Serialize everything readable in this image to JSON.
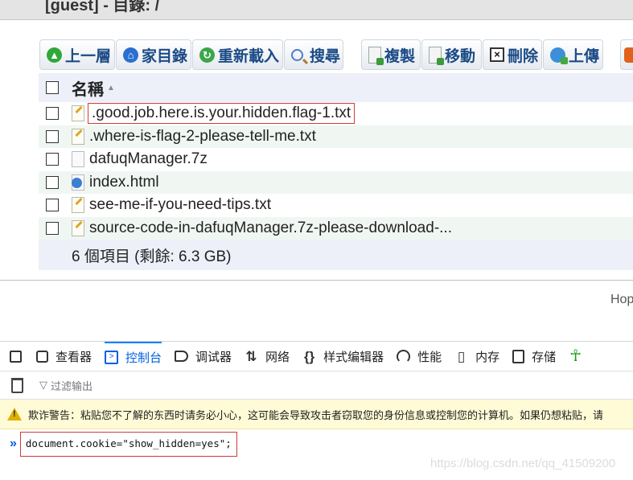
{
  "header": {
    "title": "[guest] - 目錄: /"
  },
  "toolbar": {
    "buttons": [
      {
        "label": "上一層",
        "icon": "arrow-up-icon"
      },
      {
        "label": "家目錄",
        "icon": "home-icon"
      },
      {
        "label": "重新載入",
        "icon": "reload-icon"
      },
      {
        "label": "搜尋",
        "icon": "search-icon"
      },
      {
        "label": "複製",
        "icon": "copy-icon"
      },
      {
        "label": "移動",
        "icon": "move-icon"
      },
      {
        "label": "刪除",
        "icon": "delete-icon"
      },
      {
        "label": "上傳",
        "icon": "upload-icon"
      }
    ]
  },
  "file_list": {
    "column_name": "名稱",
    "sort_indicator": "▲",
    "files": [
      {
        "name": ".good.job.here.is.your.hidden.flag-1.txt",
        "type": "text-file-icon",
        "highlighted": true
      },
      {
        "name": ".where-is-flag-2-please-tell-me.txt",
        "type": "text-file-icon"
      },
      {
        "name": "dafuqManager.7z",
        "type": "archive-file-icon"
      },
      {
        "name": "index.html",
        "type": "html-file-icon"
      },
      {
        "name": "see-me-if-you-need-tips.txt",
        "type": "text-file-icon"
      },
      {
        "name": "source-code-in-dafuqManager.7z-please-download-...",
        "type": "text-file-icon"
      }
    ],
    "summary": "6 個項目 (剩餘: 6.3 GB)"
  },
  "footer_text": "Hop",
  "devtools": {
    "tabs": [
      {
        "label": "查看器",
        "icon": "inspector-icon"
      },
      {
        "label": "控制台",
        "icon": "console-icon",
        "active": true
      },
      {
        "label": "调试器",
        "icon": "debugger-icon"
      },
      {
        "label": "网络",
        "icon": "network-icon"
      },
      {
        "label": "样式编辑器",
        "icon": "style-editor-icon"
      },
      {
        "label": "性能",
        "icon": "performance-icon"
      },
      {
        "label": "内存",
        "icon": "memory-icon"
      },
      {
        "label": "存储",
        "icon": "storage-icon"
      }
    ],
    "filter_placeholder": "过滤输出",
    "warning": "欺诈警告：粘贴您不了解的东西时请务必小心，这可能会导致攻击者窃取您的身份信息或控制您的计算机。如果仍想粘贴，请",
    "command": "document.cookie=\"show_hidden=yes\";",
    "prompt_symbol": "»",
    "active_color": "#0060df"
  },
  "watermark": "https://blog.csdn.net/qq_41509200"
}
